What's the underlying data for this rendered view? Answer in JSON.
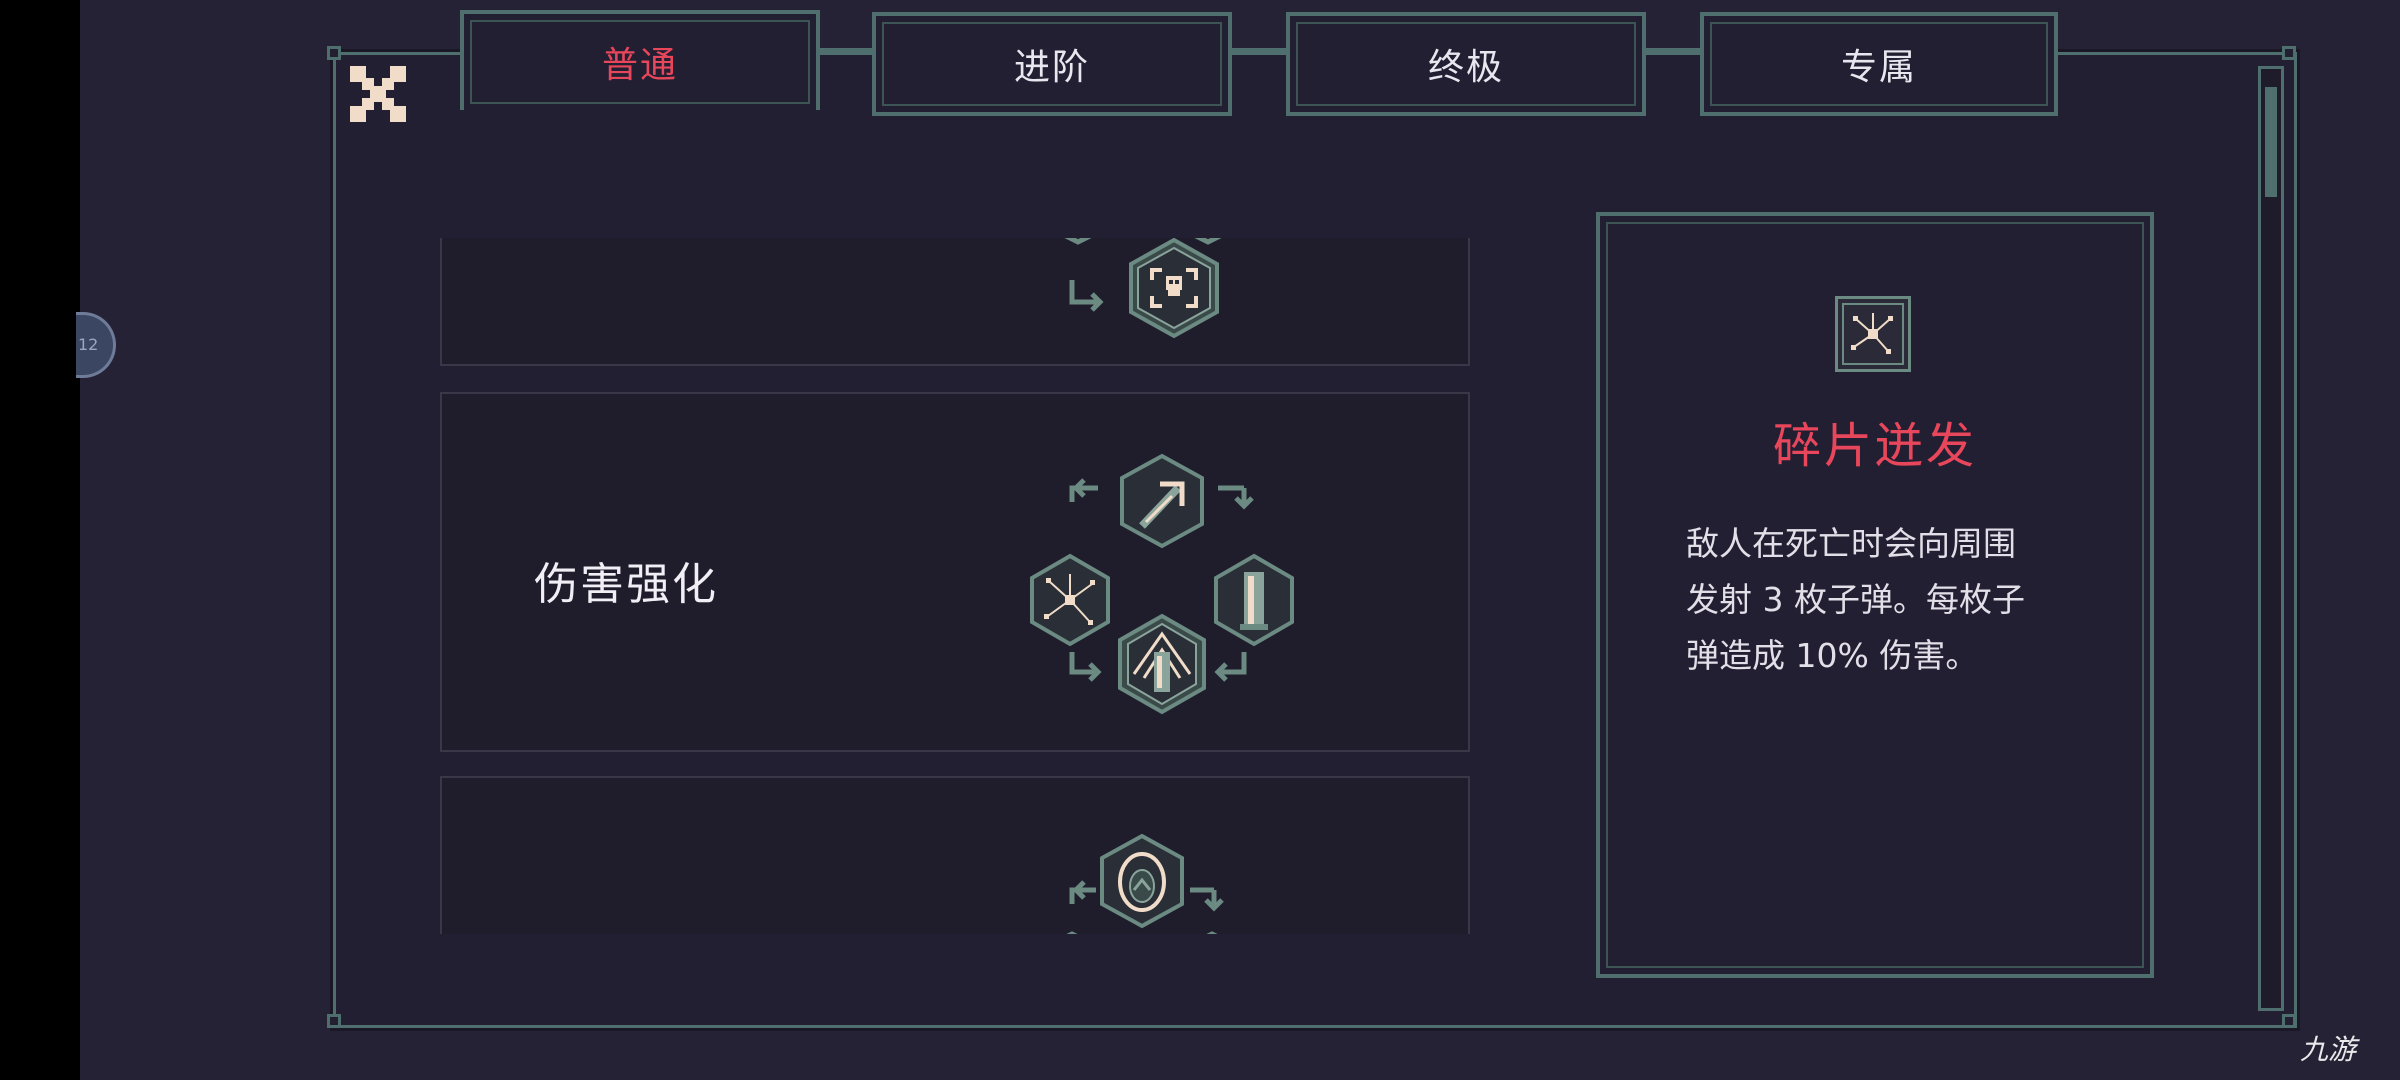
{
  "tabs": [
    {
      "label": "普通",
      "active": true
    },
    {
      "label": "进阶",
      "active": false
    },
    {
      "label": "终极",
      "active": false
    },
    {
      "label": "专属",
      "active": false
    }
  ],
  "side_bubble": {
    "text": "12"
  },
  "upgrade_list": [
    {
      "title": "",
      "center_icon": "skull-target-icon"
    },
    {
      "title": "伤害强化",
      "icons": [
        "arrow-icon",
        "shard-burst-icon",
        "bullet-icon",
        "rocket-icon"
      ]
    },
    {
      "title": "",
      "top_icon": "egg-icon"
    }
  ],
  "detail": {
    "icon": "shard-burst-icon",
    "title": "碎片迸发",
    "desc_line1": "敌人在死亡时会向周围",
    "desc_line2": "发射 3 枚子弹。每枚子",
    "desc_line3": "弹造成 10% 伤害。"
  },
  "watermark": "九游",
  "colors": {
    "background": "#262235",
    "frame": "#4f6e6e",
    "accent_red": "#e8465b",
    "icon_green": "#6b8a82",
    "icon_cream": "#f0dcc8"
  }
}
